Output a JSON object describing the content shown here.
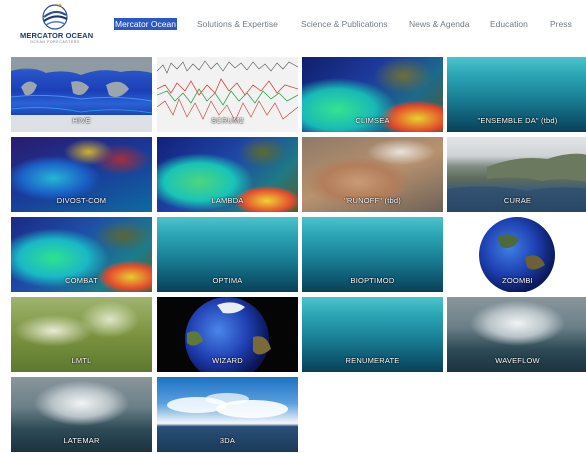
{
  "brand": {
    "name": "MERCATOR OCEAN",
    "tagline": "OCEAN FORECASTERS"
  },
  "nav": {
    "items": [
      {
        "id": "mercator",
        "label": "Mercator Ocean",
        "active": true
      },
      {
        "id": "solutions",
        "label": "Solutions & Expertise",
        "active": false
      },
      {
        "id": "science",
        "label": "Science & Publications",
        "active": false
      },
      {
        "id": "news",
        "label": "News & Agenda",
        "active": false
      },
      {
        "id": "education",
        "label": "Education",
        "active": false
      },
      {
        "id": "press",
        "label": "Press",
        "active": false
      }
    ]
  },
  "colors": {
    "nav_active_bg": "#2b59c3",
    "nav_text": "#737b86",
    "brand_blue": "#1b3a6b"
  },
  "projects": [
    {
      "label": "HIVE",
      "style": "map"
    },
    {
      "label": "SCRUM2",
      "style": "scrum"
    },
    {
      "label": "CLIMSEA",
      "style": "clim"
    },
    {
      "label": "\"ENSEMBLE DA\" (tbd)",
      "style": "sea"
    },
    {
      "label": "DIVOST-COM",
      "style": "divost"
    },
    {
      "label": "LAMBDA",
      "style": "lambda"
    },
    {
      "label": "\"RUNOFF\" (tbd)",
      "style": "runoff"
    },
    {
      "label": "CURAE",
      "style": "curae"
    },
    {
      "label": "COMBAT",
      "style": "combat"
    },
    {
      "label": "OPTIMA",
      "style": "sea"
    },
    {
      "label": "BIOPTIMOD",
      "style": "sea"
    },
    {
      "label": "ZOOMBI",
      "style": "globe"
    },
    {
      "label": "LMTL",
      "style": "lmtl"
    },
    {
      "label": "WIZARD",
      "style": "globe2"
    },
    {
      "label": "RENUMERATE",
      "style": "sea"
    },
    {
      "label": "WAVEFLOW",
      "style": "wave"
    },
    {
      "label": "LATEMAR",
      "style": "wave"
    },
    {
      "label": "3DA",
      "style": "3da"
    }
  ]
}
